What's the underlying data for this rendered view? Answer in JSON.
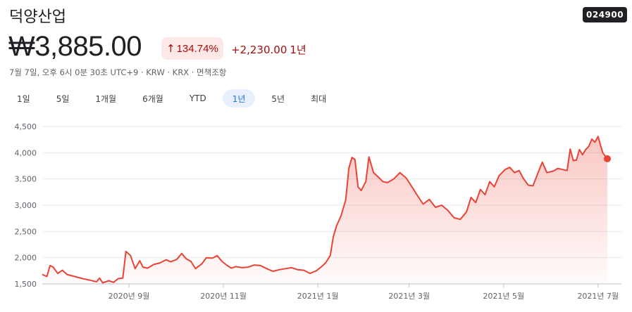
{
  "company": {
    "name": "덕양산업",
    "ticker": "024900"
  },
  "quote": {
    "price": "₩3,885.00",
    "change_arrow": "↑",
    "change_percent": "134.74%",
    "change_absolute": "+2,230.00",
    "change_period": "1년",
    "meta": "7월 7일, 오후 6시 0분 30초 UTC+9 · KRW · KRX · 면책조항"
  },
  "range_tabs": [
    {
      "label": "1일",
      "active": false
    },
    {
      "label": "5일",
      "active": false
    },
    {
      "label": "1개월",
      "active": false
    },
    {
      "label": "6개월",
      "active": false
    },
    {
      "label": "YTD",
      "active": false
    },
    {
      "label": "1년",
      "active": true
    },
    {
      "label": "5년",
      "active": false
    },
    {
      "label": "최대",
      "active": false
    }
  ],
  "colors": {
    "line": "#ea4335",
    "fill": "#ea4335",
    "positive": "#a50e0e",
    "accent": "#1a73e8"
  },
  "chart_data": {
    "type": "area",
    "title": "",
    "xlabel": "",
    "ylabel": "",
    "ylim": [
      1500,
      4500
    ],
    "yticks": [
      1500,
      2000,
      2500,
      3000,
      3500,
      4000,
      4500
    ],
    "ytick_labels": [
      "1,500",
      "2,000",
      "2,500",
      "3,000",
      "3,500",
      "4,000",
      "4,500"
    ],
    "xlim": [
      "2020-07-07",
      "2021-07-07"
    ],
    "xticks": [
      {
        "date": "2020-09-01",
        "label": "2020년 9월"
      },
      {
        "date": "2020-11-01",
        "label": "2020년 11월"
      },
      {
        "date": "2021-01-01",
        "label": "2021년 1월"
      },
      {
        "date": "2021-03-01",
        "label": "2021년 3월"
      },
      {
        "date": "2021-05-01",
        "label": "2021년 5월"
      },
      {
        "date": "2021-07-01",
        "label": "2021년 7월"
      }
    ],
    "grid": true,
    "last_point_marker": true,
    "series": [
      {
        "points": [
          [
            "2020-07-07",
            1680
          ],
          [
            "2020-07-10",
            1640
          ],
          [
            "2020-07-12",
            1850
          ],
          [
            "2020-07-14",
            1820
          ],
          [
            "2020-07-17",
            1700
          ],
          [
            "2020-07-20",
            1760
          ],
          [
            "2020-07-23",
            1680
          ],
          [
            "2020-07-28",
            1640
          ],
          [
            "2020-08-02",
            1600
          ],
          [
            "2020-08-07",
            1570
          ],
          [
            "2020-08-11",
            1540
          ],
          [
            "2020-08-13",
            1610
          ],
          [
            "2020-08-15",
            1520
          ],
          [
            "2020-08-19",
            1560
          ],
          [
            "2020-08-22",
            1530
          ],
          [
            "2020-08-25",
            1600
          ],
          [
            "2020-08-28",
            1610
          ],
          [
            "2020-08-30",
            2120
          ],
          [
            "2020-09-02",
            2040
          ],
          [
            "2020-09-05",
            1790
          ],
          [
            "2020-09-08",
            1940
          ],
          [
            "2020-09-10",
            1820
          ],
          [
            "2020-09-13",
            1800
          ],
          [
            "2020-09-17",
            1870
          ],
          [
            "2020-09-21",
            1900
          ],
          [
            "2020-09-25",
            1960
          ],
          [
            "2020-09-28",
            1920
          ],
          [
            "2020-10-02",
            1970
          ],
          [
            "2020-10-05",
            2080
          ],
          [
            "2020-10-08",
            1980
          ],
          [
            "2020-10-11",
            1930
          ],
          [
            "2020-10-14",
            1790
          ],
          [
            "2020-10-18",
            1880
          ],
          [
            "2020-10-21",
            2000
          ],
          [
            "2020-10-25",
            1990
          ],
          [
            "2020-10-28",
            2040
          ],
          [
            "2020-10-31",
            1930
          ],
          [
            "2020-11-03",
            1860
          ],
          [
            "2020-11-06",
            1800
          ],
          [
            "2020-11-09",
            1830
          ],
          [
            "2020-11-13",
            1810
          ],
          [
            "2020-11-17",
            1820
          ],
          [
            "2020-11-21",
            1860
          ],
          [
            "2020-11-25",
            1850
          ],
          [
            "2020-11-29",
            1790
          ],
          [
            "2020-12-03",
            1740
          ],
          [
            "2020-12-07",
            1770
          ],
          [
            "2020-12-11",
            1790
          ],
          [
            "2020-12-15",
            1810
          ],
          [
            "2020-12-19",
            1770
          ],
          [
            "2020-12-23",
            1760
          ],
          [
            "2020-12-27",
            1700
          ],
          [
            "2020-12-31",
            1750
          ],
          [
            "2021-01-03",
            1820
          ],
          [
            "2021-01-06",
            1900
          ],
          [
            "2021-01-09",
            2040
          ],
          [
            "2021-01-11",
            2400
          ],
          [
            "2021-01-13",
            2600
          ],
          [
            "2021-01-16",
            2800
          ],
          [
            "2021-01-19",
            3100
          ],
          [
            "2021-01-21",
            3700
          ],
          [
            "2021-01-23",
            3910
          ],
          [
            "2021-01-25",
            3870
          ],
          [
            "2021-01-27",
            3350
          ],
          [
            "2021-01-29",
            3280
          ],
          [
            "2021-02-01",
            3450
          ],
          [
            "2021-02-03",
            3920
          ],
          [
            "2021-02-06",
            3620
          ],
          [
            "2021-02-09",
            3540
          ],
          [
            "2021-02-12",
            3450
          ],
          [
            "2021-02-15",
            3430
          ],
          [
            "2021-02-19",
            3500
          ],
          [
            "2021-02-23",
            3620
          ],
          [
            "2021-02-27",
            3520
          ],
          [
            "2021-03-03",
            3340
          ],
          [
            "2021-03-06",
            3200
          ],
          [
            "2021-03-10",
            3020
          ],
          [
            "2021-03-14",
            3110
          ],
          [
            "2021-03-18",
            2960
          ],
          [
            "2021-03-22",
            3000
          ],
          [
            "2021-03-26",
            2900
          ],
          [
            "2021-03-30",
            2760
          ],
          [
            "2021-04-03",
            2730
          ],
          [
            "2021-04-07",
            2870
          ],
          [
            "2021-04-10",
            3150
          ],
          [
            "2021-04-13",
            3050
          ],
          [
            "2021-04-16",
            3300
          ],
          [
            "2021-04-19",
            3200
          ],
          [
            "2021-04-22",
            3450
          ],
          [
            "2021-04-25",
            3350
          ],
          [
            "2021-04-28",
            3560
          ],
          [
            "2021-05-02",
            3680
          ],
          [
            "2021-05-05",
            3720
          ],
          [
            "2021-05-08",
            3620
          ],
          [
            "2021-05-11",
            3660
          ],
          [
            "2021-05-14",
            3500
          ],
          [
            "2021-05-17",
            3380
          ],
          [
            "2021-05-20",
            3370
          ],
          [
            "2021-05-23",
            3600
          ],
          [
            "2021-05-26",
            3820
          ],
          [
            "2021-05-29",
            3620
          ],
          [
            "2021-06-02",
            3650
          ],
          [
            "2021-06-05",
            3700
          ],
          [
            "2021-06-08",
            3680
          ],
          [
            "2021-06-11",
            3660
          ],
          [
            "2021-06-13",
            4070
          ],
          [
            "2021-06-15",
            3850
          ],
          [
            "2021-06-17",
            3860
          ],
          [
            "2021-06-19",
            4060
          ],
          [
            "2021-06-21",
            3960
          ],
          [
            "2021-06-23",
            4060
          ],
          [
            "2021-06-25",
            4120
          ],
          [
            "2021-06-27",
            4260
          ],
          [
            "2021-06-29",
            4200
          ],
          [
            "2021-07-01",
            4310
          ],
          [
            "2021-07-04",
            4000
          ],
          [
            "2021-07-07",
            3885
          ]
        ]
      }
    ]
  }
}
